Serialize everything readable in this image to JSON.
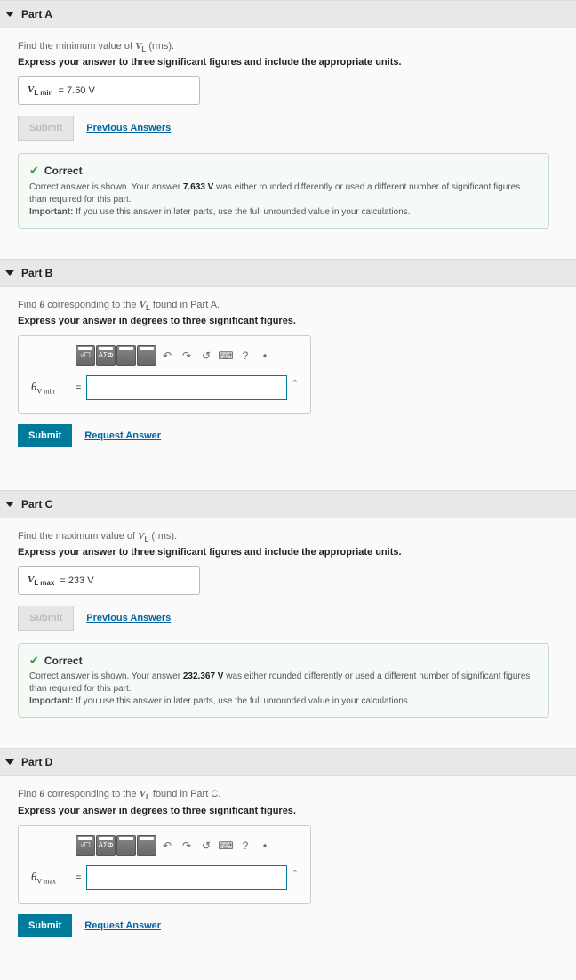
{
  "buttons": {
    "submit": "Submit",
    "previous": "Previous Answers",
    "request": "Request Answer"
  },
  "feedback": {
    "correct": "Correct",
    "line1_pre": "Correct answer is shown. Your answer ",
    "line1_post": " was either rounded differently or used a different number of significant figures than required for this part.",
    "line2_label": "Important:",
    "line2": " If you use this answer in later parts, use the full unrounded value in your calculations."
  },
  "toolbar_icons": {
    "undo": "↶",
    "redo": "↷",
    "reset": "↺",
    "keyboard": "⌨",
    "help": "?"
  },
  "parts": {
    "A": {
      "title": "Part A",
      "instr_pre": "Find the minimum value of ",
      "instr_post": " (rms).",
      "express": "Express your answer to three significant figures and include the appropriate units.",
      "var_html": "V<sub>L min</sub>",
      "answer": "7.60 V",
      "your_answer": "7.633 V"
    },
    "B": {
      "title": "Part B",
      "instr_pre": "Find ",
      "instr_mid": " corresponding to the ",
      "instr_post": " found in Part A.",
      "express": "Express your answer in degrees to three significant figures.",
      "label": "θ<sub>V min</sub>"
    },
    "C": {
      "title": "Part C",
      "instr_pre": "Find the maximum value of ",
      "instr_post": " (rms).",
      "express": "Express your answer to three significant figures and include the appropriate units.",
      "var_html": "V<sub>L max</sub>",
      "answer": "233 V",
      "your_answer": "232.367 V"
    },
    "D": {
      "title": "Part D",
      "instr_pre": "Find ",
      "instr_mid": " corresponding to the ",
      "instr_post": " found in Part C.",
      "express": "Express your answer in degrees to three significant figures.",
      "label": "θ<sub>V max</sub>"
    }
  }
}
